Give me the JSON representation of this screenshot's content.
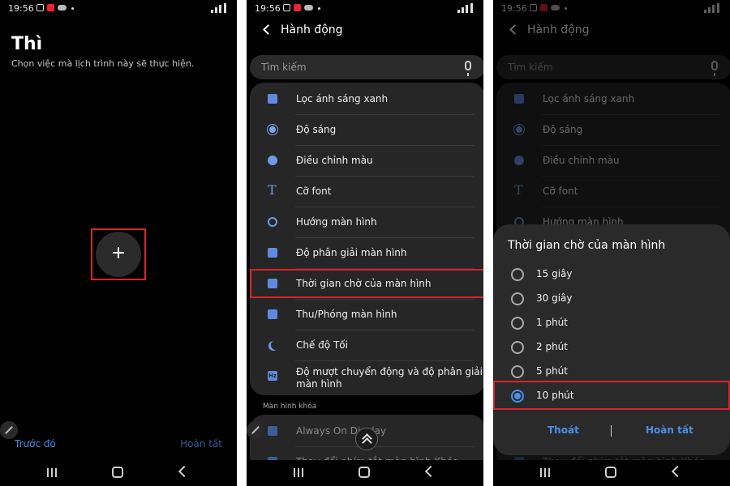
{
  "status": {
    "time": "19:56"
  },
  "screen1": {
    "title": "Thì",
    "subtitle": "Chọn việc mà lịch trình này sẽ thực hiện.",
    "add_symbol": "+",
    "prev_label": "Trước đó",
    "done_label": "Hoàn tất"
  },
  "screen2": {
    "title": "Hành động",
    "search_placeholder": "Tìm kiếm",
    "actions": [
      {
        "label": "Lọc ánh sáng xanh",
        "icon": "blue-light-filter-icon"
      },
      {
        "label": "Độ sáng",
        "icon": "brightness-icon"
      },
      {
        "label": "Điều chỉnh màu",
        "icon": "palette-icon"
      },
      {
        "label": "Cỡ font",
        "icon": "font-size-icon"
      },
      {
        "label": "Hướng màn hình",
        "icon": "screen-rotation-icon"
      },
      {
        "label": "Độ phân giải màn hình",
        "icon": "resolution-icon"
      },
      {
        "label": "Thời gian chờ của màn hình",
        "icon": "screen-timeout-icon"
      },
      {
        "label": "Thu/Phóng màn hình",
        "icon": "zoom-icon"
      },
      {
        "label": "Chế độ Tối",
        "icon": "moon-icon"
      },
      {
        "label": "Độ mượt chuyển động và độ phân giải màn hình",
        "icon": "hz-icon"
      }
    ],
    "section_lock": "Màn hình khóa",
    "lock_items": [
      {
        "label": "Always On Display"
      },
      {
        "label": "Thay đổi phím tắt màn hình Khóa"
      }
    ]
  },
  "screen3": {
    "dialog_title": "Thời gian chờ của màn hình",
    "options": [
      "15 giây",
      "30 giây",
      "1 phút",
      "2 phút",
      "5 phút",
      "10 phút"
    ],
    "selected_option": "10 phút",
    "exit_label": "Thoát",
    "done_label": "Hoàn tất"
  },
  "colors": {
    "accent": "#4a8fe9",
    "highlight": "#d8232a",
    "card": "#262626"
  }
}
